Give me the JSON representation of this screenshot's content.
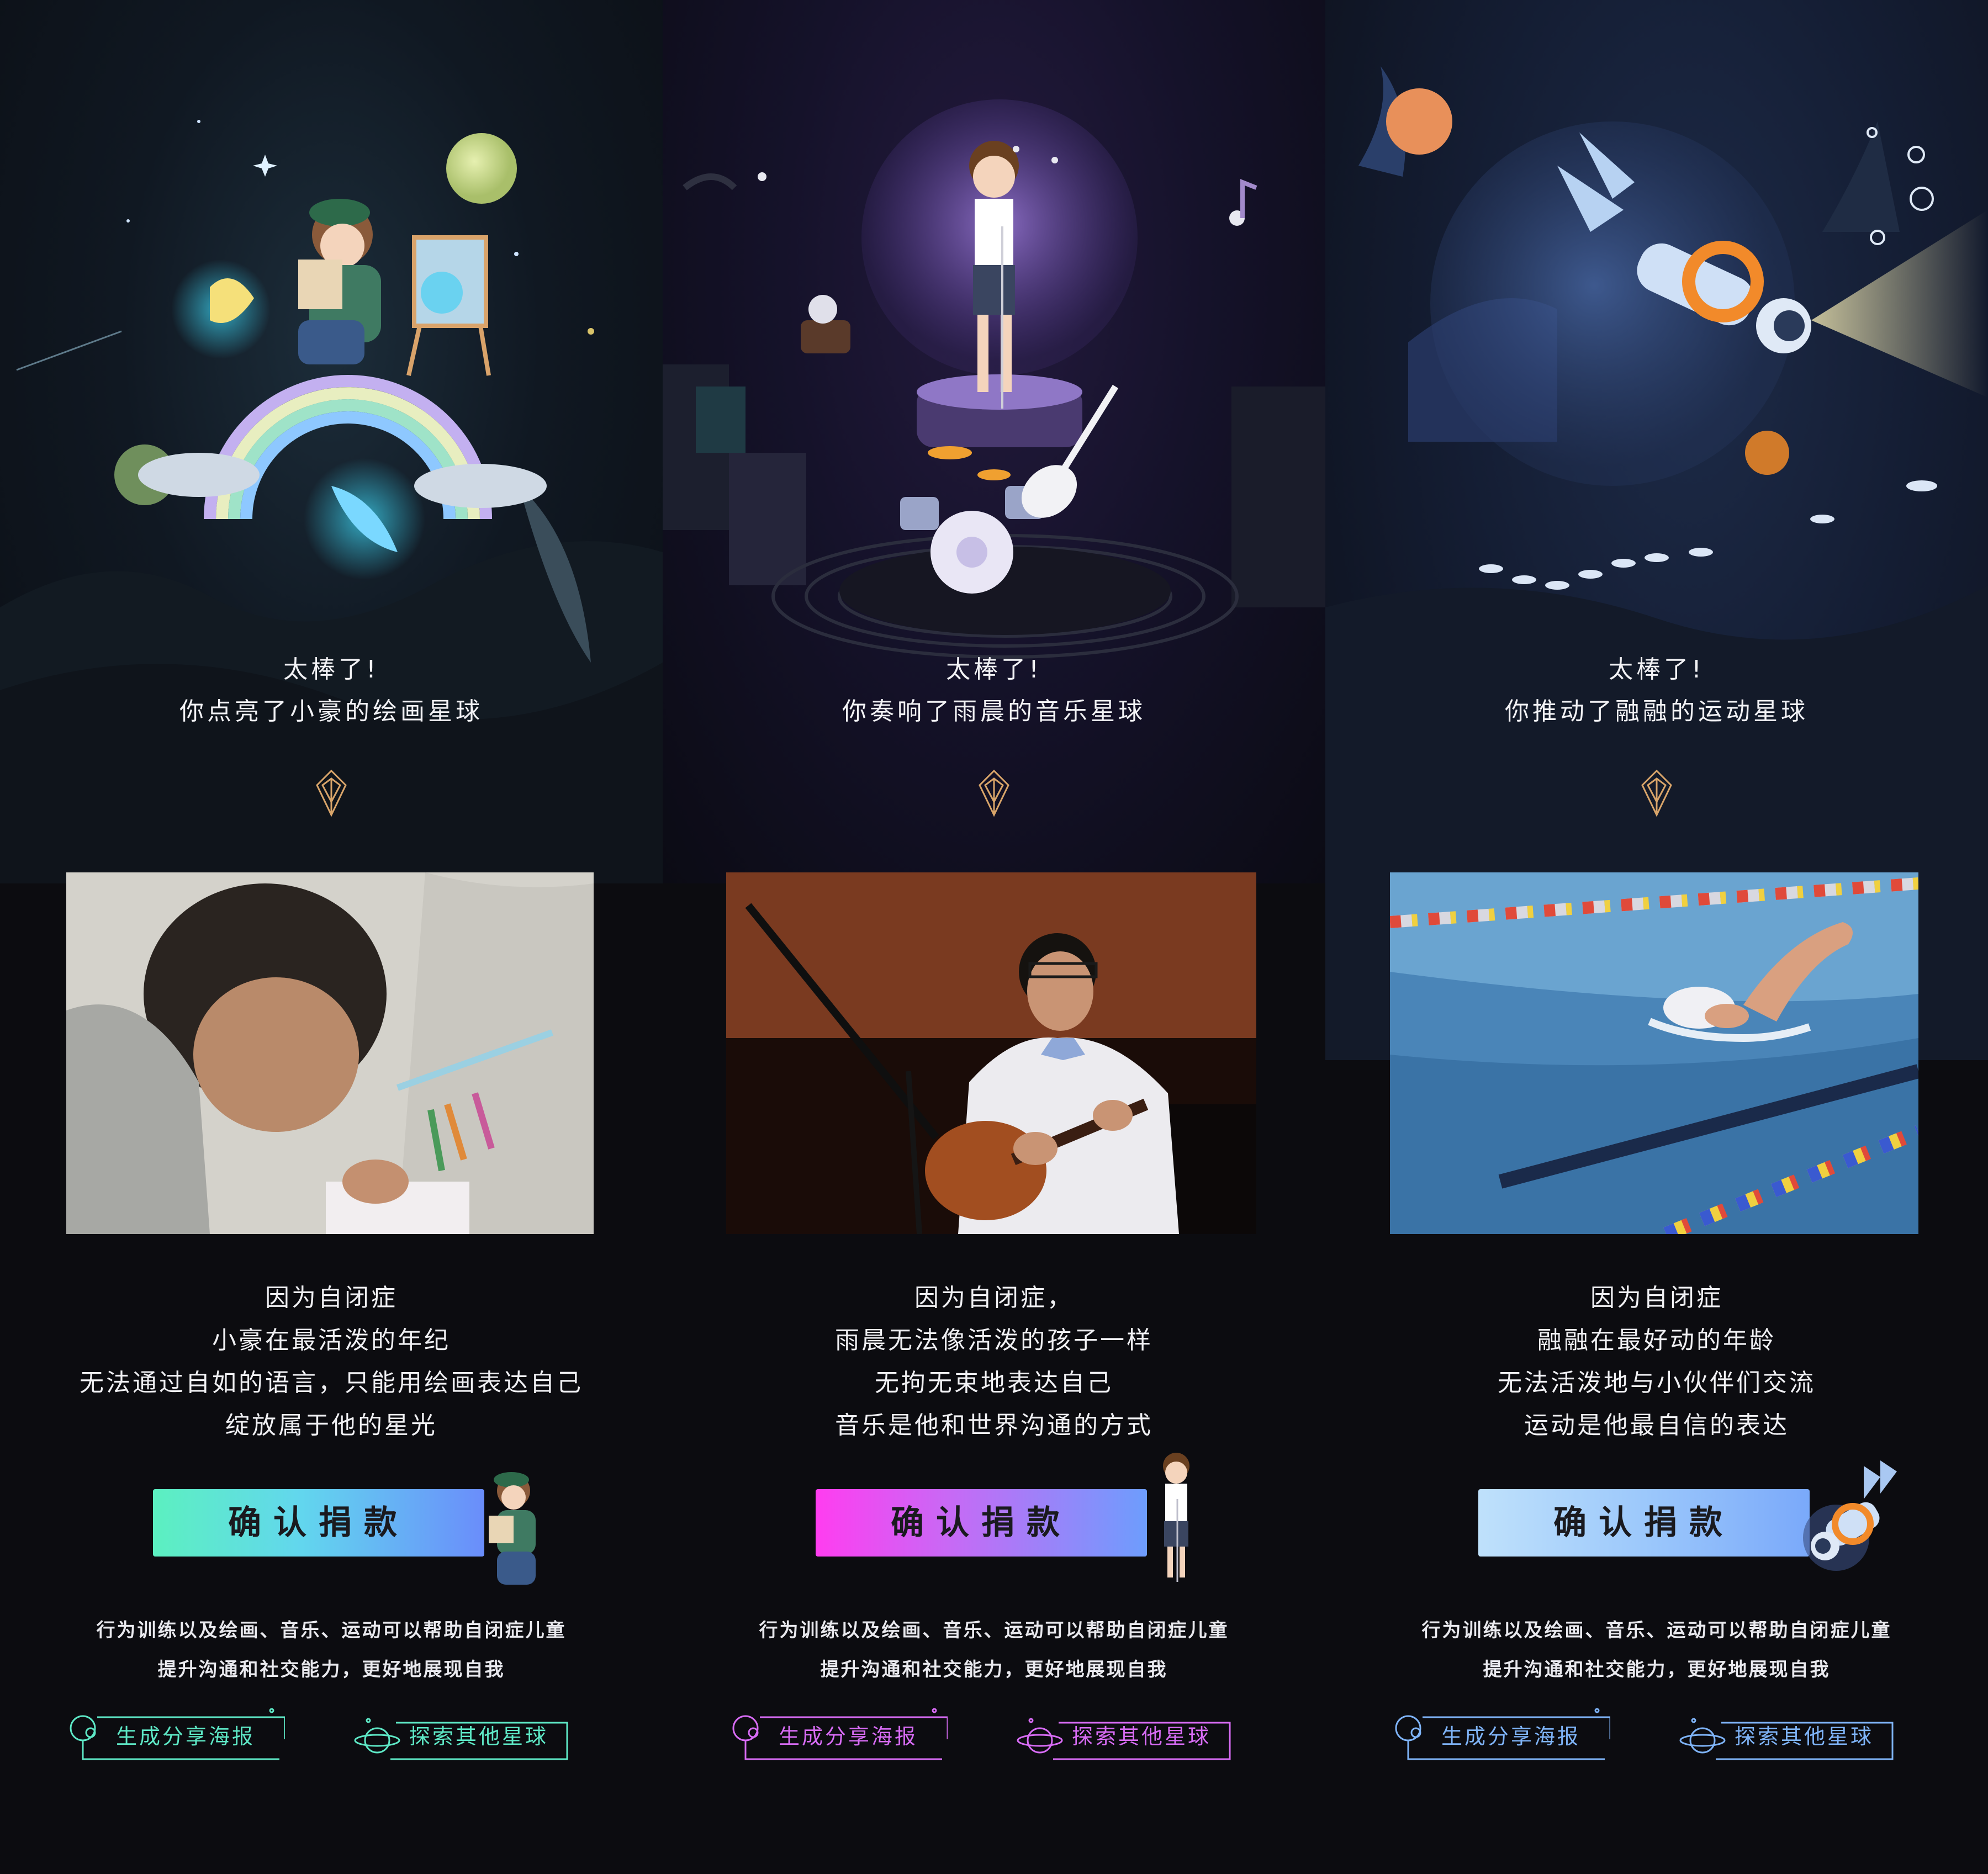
{
  "screens": [
    {
      "theme": "painting",
      "headline": {
        "line1": "太棒了!",
        "line2": "你点亮了小豪的绘画星球"
      },
      "story": [
        "因为自闭症",
        "小豪在最活泼的年纪",
        "无法通过自如的语言，只能用绘画表达自己",
        "绽放属于他的星光"
      ],
      "cta_label": "确认捐款",
      "note": {
        "line1": "行为训练以及绘画、音乐、运动可以帮助自闭症儿童",
        "line2": "提升沟通和社交能力，更好地展现自我"
      },
      "share_label": "生成分享海报",
      "explore_label": "探索其他星球",
      "accent": "#5ee8c6"
    },
    {
      "theme": "music",
      "headline": {
        "line1": "太棒了!",
        "line2": "你奏响了雨晨的音乐星球"
      },
      "story": [
        "因为自闭症，",
        "雨晨无法像活泼的孩子一样",
        "无拘无束地表达自己",
        "音乐是他和世界沟通的方式"
      ],
      "cta_label": "确认捐款",
      "note": {
        "line1": "行为训练以及绘画、音乐、运动可以帮助自闭症儿童",
        "line2": "提升沟通和社交能力，更好地展现自我"
      },
      "share_label": "生成分享海报",
      "explore_label": "探索其他星球",
      "accent": "#d86cf5"
    },
    {
      "theme": "sports",
      "headline": {
        "line1": "太棒了!",
        "line2": "你推动了融融的运动星球"
      },
      "story": [
        "因为自闭症",
        "融融在最好动的年龄",
        "无法活泼地与小伙伴们交流",
        "运动是他最自信的表达"
      ],
      "cta_label": "确认捐款",
      "note": {
        "line1": "行为训练以及绘画、音乐、运动可以帮助自闭症儿童",
        "line2": "提升沟通和社交能力，更好地展现自我"
      },
      "share_label": "生成分享海报",
      "explore_label": "探索其他星球",
      "accent": "#7fb4f8"
    }
  ],
  "icons": {
    "emblem": "diamond-emblem-icon",
    "share": "planet-ring-icon",
    "explore": "saturn-icon"
  }
}
